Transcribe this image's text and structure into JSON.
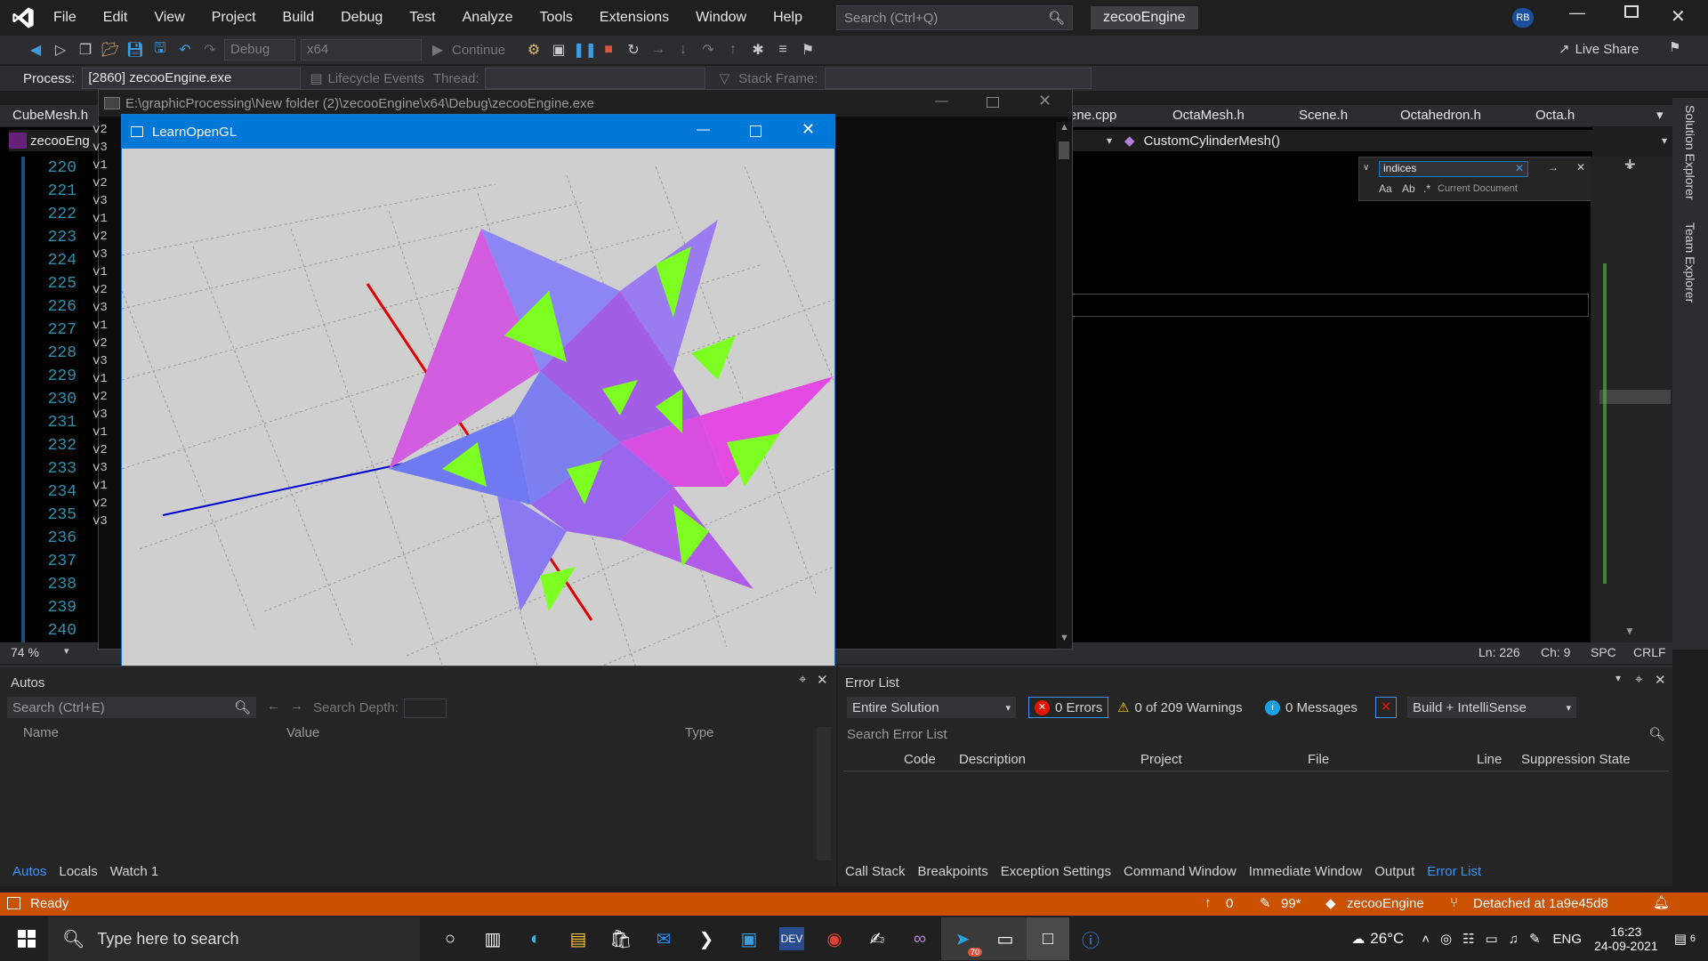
{
  "menubar": {
    "items": [
      "File",
      "Edit",
      "View",
      "Project",
      "Build",
      "Debug",
      "Test",
      "Analyze",
      "Tools",
      "Extensions",
      "Window",
      "Help"
    ],
    "search_placeholder": "Search (Ctrl+Q)",
    "solution_name": "zecooEngine",
    "user_initials": "RB",
    "live_share": "Live Share"
  },
  "toolbar": {
    "config": "Debug",
    "platform": "x64",
    "continue_label": "Continue"
  },
  "debugbar": {
    "process_label": "Process:",
    "process_value": "[2860] zecooEngine.exe",
    "lifecycle_label": "Lifecycle Events",
    "thread_label": "Thread:",
    "stack_label": "Stack Frame:"
  },
  "doctabs": {
    "left": [
      "CubeMesh.h"
    ],
    "right": [
      "ene.cpp",
      "OctaMesh.h",
      "Scene.h",
      "Octahedron.h",
      "Octa.h"
    ],
    "active_file_short": "zecooEng",
    "member_combo": "CustomCylinderMesh()"
  },
  "editor": {
    "line_numbers": [
      "220",
      "221",
      "222",
      "223",
      "224",
      "225",
      "226",
      "227",
      "228",
      "229",
      "230",
      "231",
      "232",
      "233",
      "234",
      "235",
      "236",
      "237",
      "238",
      "239",
      "240"
    ],
    "console_lines": [
      "v2",
      "v3",
      "v1",
      "v2",
      "v3",
      "v1",
      "v2",
      "v3",
      "v1",
      "v2",
      "v3",
      "v1",
      "v2",
      "v3",
      "v1",
      "v2",
      "v3",
      "v1",
      "v2",
      "v3",
      "v1",
      "v2",
      "v3"
    ],
    "zoom": "74 %",
    "status": {
      "line": "Ln: 226",
      "col": "Ch: 9",
      "spc": "SPC",
      "eol": "CRLF"
    }
  },
  "find": {
    "query": "indices",
    "scope": "Current Document"
  },
  "console_window": {
    "title": "E:\\graphicProcessing\\New folder (2)\\zecooEngine\\x64\\Debug\\zecooEngine.exe"
  },
  "gl_window": {
    "title": "LearnOpenGL"
  },
  "sidepane": {
    "items": [
      "Solution Explorer",
      "Team Explorer"
    ]
  },
  "autos": {
    "title": "Autos",
    "search_placeholder": "Search (Ctrl+E)",
    "search_depth_label": "Search Depth:",
    "columns": [
      "Name",
      "Value",
      "Type"
    ],
    "tabs": [
      "Autos",
      "Locals",
      "Watch 1"
    ]
  },
  "errlist": {
    "title": "Error List",
    "scope": "Entire Solution",
    "errors": "0 Errors",
    "warnings": "0 of 209 Warnings",
    "messages": "0 Messages",
    "build_filter": "Build + IntelliSense",
    "search_placeholder": "Search Error List",
    "columns": [
      "Code",
      "Description",
      "Project",
      "File",
      "Line",
      "Suppression State"
    ],
    "tabs": [
      "Call Stack",
      "Breakpoints",
      "Exception Settings",
      "Command Window",
      "Immediate Window",
      "Output",
      "Error List"
    ]
  },
  "statusbar": {
    "state": "Ready",
    "up_count": "0",
    "edit_count": "99*",
    "repo": "zecooEngine",
    "branch": "Detached at 1a9e45d8"
  },
  "taskbar": {
    "search_placeholder": "Type here to search",
    "weather": "26°C",
    "language": "ENG",
    "time": "16:23",
    "date": "24-09-2021",
    "notification_count": "6",
    "telegram_badge": "70"
  },
  "colors": {
    "accent": "#0078d7",
    "statusbar": "#ca5100",
    "error_list_active": "#3794ff"
  }
}
